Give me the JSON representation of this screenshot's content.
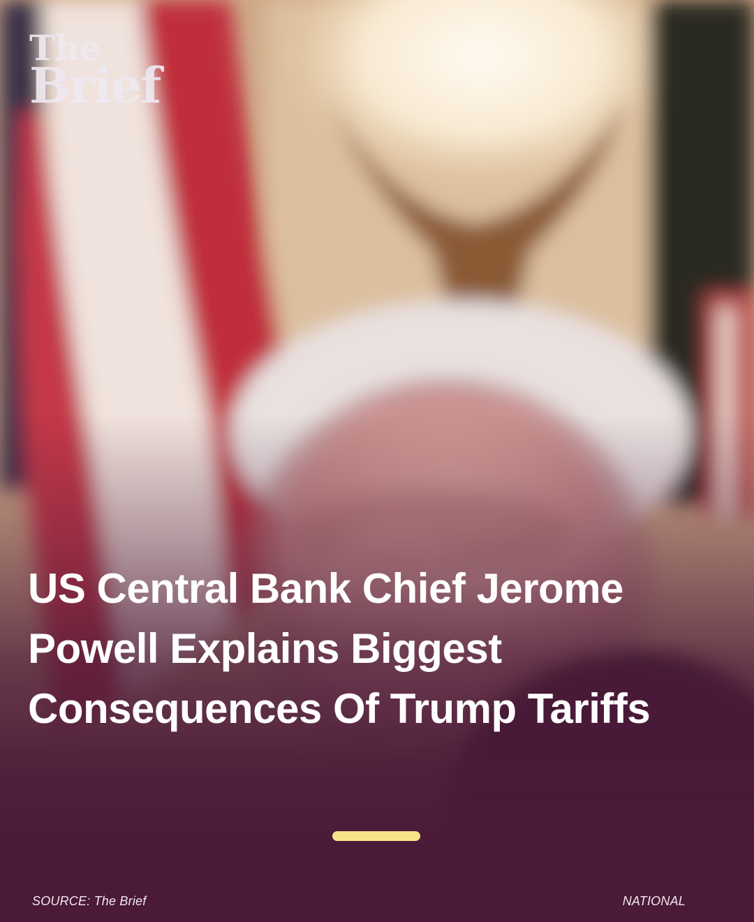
{
  "brand": {
    "logo_line1": "The",
    "logo_line2": "Brief"
  },
  "headline": "US Central Bank Chief Jerome Powell Explains Biggest Consequences Of Trump Tariffs",
  "footer": {
    "source": "SOURCE: The Brief",
    "category": "NATIONAL"
  },
  "colors": {
    "overlay": "#4a1a38",
    "accent_bar": "#f7e48a",
    "text": "#ffffff"
  }
}
